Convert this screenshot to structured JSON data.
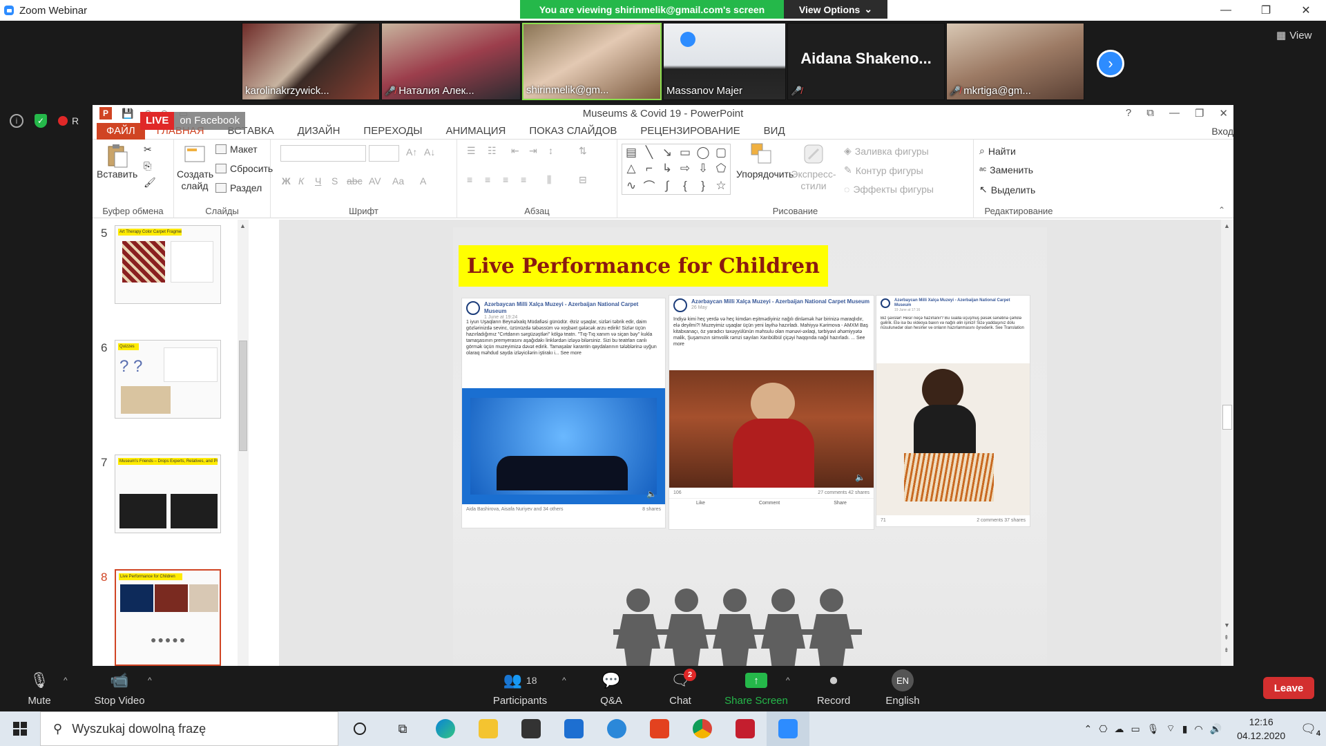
{
  "zoom": {
    "window_title": "Zoom Webinar",
    "share_banner": "You are viewing shirinmelik@gmail.com's screen",
    "view_options": "View Options",
    "view_label": "View",
    "recording_label": "R"
  },
  "participants": [
    {
      "name": "karolinakrzywick...",
      "muted": false
    },
    {
      "name": "Наталия Алек...",
      "muted": true
    },
    {
      "name": "shirinmelik@gm...",
      "muted": false,
      "active": true
    },
    {
      "name": "Massanov Majer",
      "muted": false
    },
    {
      "name": "Aidana Shakeno...",
      "muted": true,
      "no_video": true
    },
    {
      "name": "mkrtiga@gm...",
      "muted": true
    }
  ],
  "live": {
    "label": "LIVE",
    "platform": "on Facebook"
  },
  "ppt": {
    "title": "Museums & Covid 19 - PowerPoint",
    "sign_in": "Вход",
    "help": "?",
    "tabs": [
      "ФАЙЛ",
      "ГЛАВНАЯ",
      "ВСТАВКА",
      "ДИЗАЙН",
      "ПЕРЕХОДЫ",
      "АНИМАЦИЯ",
      "ПОКАЗ СЛАЙДОВ",
      "РЕЦЕНЗИРОВАНИЕ",
      "ВИД"
    ],
    "ribbon": {
      "paste": "Вставить",
      "clipboard": "Буфер обмена",
      "new_slide_1": "Создать",
      "new_slide_2": "слайд",
      "layout": "Макет",
      "reset": "Сбросить",
      "section": "Раздел",
      "slides": "Слайды",
      "font": "Шрифт",
      "paragraph": "Абзац",
      "arrange": "Упорядочить",
      "quick_styles_1": "Экспресс-",
      "quick_styles_2": "стили",
      "shape_fill": "Заливка фигуры",
      "shape_outline": "Контур фигуры",
      "shape_effects": "Эффекты фигуры",
      "drawing": "Рисование",
      "find": "Найти",
      "replace": "Заменить",
      "select": "Выделить",
      "editing": "Редактирование"
    },
    "thumbnails": [
      {
        "num": "5",
        "title": "Art Therapy Color Carpet Fragment"
      },
      {
        "num": "6",
        "title": "Quizzes"
      },
      {
        "num": "7",
        "title": "Museum's Friends – Drops Experts, Relatives, and Philanthropists"
      },
      {
        "num": "8",
        "title": "Live Performance for Children",
        "selected": true
      }
    ],
    "slide": {
      "title": "Live Performance for Children",
      "posts": [
        {
          "page": "Azərbaycan Milli Xalça Muzeyi - Azerbaijan National Carpet Museum",
          "date": "1 June at 19:24",
          "text": "1 iyun Uşaqların Beynəlxalq Müdafiəsi günüdür. Əziz uşaqlar, sizləri təbrik edir, daim gözlərinizdə sevinc, üzünüzdə təbəssüm və xoşbəxt gələcək arzu edirik! Sizlər üçün hazırladığımız \"Cırtdanın sərgüzəştləri\" kölgə teatrı. \"Tıq-Tıq xanım və siçan bəy\" kukla tamaşasının premyerasını aşağıdakı linklərdən izləyə bilərsiniz. Sizi bu teatrları canlı görmək üçün muzeyimizə dəvət edirik. Tamaşalar karantin qaydalarının tələblərinə uyğun olaraq məhdud sayda izləyicilərin iştirakı i... See more",
          "reactions": "Aida Bashirova, Aisafa Nuriyev and 34 others",
          "shares": "8 shares"
        },
        {
          "page": "Azərbaycan Milli Xalça Muzeyi - Azerbaijan National Carpet Museum",
          "date": "26 May",
          "text": "İndiyə kimi heç yerdə və heç kimdən eşitmədiyiniz nağılı dinləmək hər birinizə maraqlıdır, elə deyilmi?! Muzeyimiz uşaqlar üçün yeni layihə hazırladı. Mahiyyə Kərimova - AMXM Baş kitabxanaçı, öz yaradıcı təxəyyülünün məhsulu olan mənəvi-əxlaqi, tərbiyəvi əhəmiyyətə malik, Şuşamızın simvolik rəmzi sayılan Xarıbülbül çiçəyi haqqında nağıl hazırladı. ... See more",
          "reactions": "106",
          "shares": "27 comments 42 shares",
          "like": "Like",
          "comment": "Comment",
          "share": "Share"
        },
        {
          "page": "Azərbaycan Milli Xalça Muzeyi - Azerbaijan National Carpet Museum",
          "date": "19 June at 17:16",
          "text": "Biz şəxslər! Hesir neçə hazırlanır? Bu sualla üçuşmuş pəsək sənətinə çərkilə gəlirik. Elə isə bu videoya baxın və nağılı əlin işinizi! Sizə yaddaşınız dolu nüsulunədər olan hesirlər və onların hazırlanmasını öyrədərik. See Translation",
          "reactions": "71",
          "shares": "2 comments 37 shares"
        }
      ]
    }
  },
  "toolbar": {
    "mute": "Mute",
    "stop_video": "Stop Video",
    "participants": "Participants",
    "participants_count": "18",
    "qa": "Q&A",
    "chat": "Chat",
    "chat_badge": "2",
    "share_screen": "Share Screen",
    "record": "Record",
    "language_code": "EN",
    "language": "English",
    "leave": "Leave"
  },
  "taskbar": {
    "search_placeholder": "Wyszukaj dowolną frazę",
    "time": "12:16",
    "date": "04.12.2020",
    "notifications": "4"
  }
}
